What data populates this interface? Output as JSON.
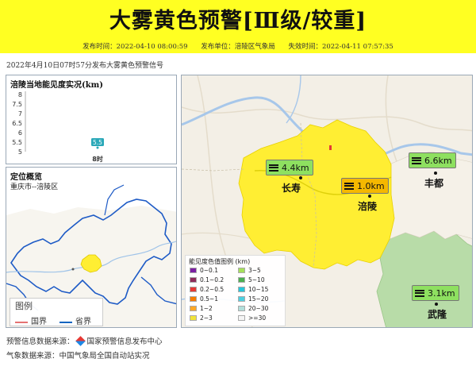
{
  "banner": {
    "title": "大雾黄色预警[Ⅲ级/较重]",
    "publish_time": "发布时间：2022-04-10 08:00:59",
    "publisher": "发布单位：涪陵区气象局",
    "expire_time": "失效时间：2022-04-11 07:57:35",
    "background_color": "#ffff22"
  },
  "headline": "2022年4月10日07时57分发布大雾黄色预警信号",
  "visibility_panel": {
    "title": "涪陵当地能见度实况(km)",
    "chart_data": {
      "type": "scatter",
      "categories": [
        "8时"
      ],
      "values": [
        5.5
      ],
      "data_labels": [
        "5.5"
      ],
      "yticks": [
        "5",
        "5.5",
        "6",
        "6.5",
        "7",
        "7.5",
        "8"
      ],
      "ylim": [
        5,
        8
      ],
      "title": "涪陵当地能见度实况(km)",
      "xlabel": "",
      "ylabel": "",
      "grid": false,
      "marker_color": "#2aa8b8"
    }
  },
  "locator_panel": {
    "title": "定位概览",
    "subtitle": "重庆市--涪陵区",
    "legend_title": "图例",
    "legend_items": [
      {
        "label": "国界",
        "color": "#e57373"
      },
      {
        "label": "省界",
        "color": "#1565c0"
      }
    ]
  },
  "main_map": {
    "stations": [
      {
        "name": "长寿",
        "visibility": "4.4km",
        "badge_color": "#8ee060"
      },
      {
        "name": "涪陵",
        "visibility": "1.0km",
        "badge_color": "#f5b800"
      },
      {
        "name": "丰都",
        "visibility": "6.6km",
        "badge_color": "#8ee060"
      },
      {
        "name": "武隆",
        "visibility": "3.1km",
        "badge_color": "#8ee060"
      }
    ],
    "warning_area_color": "#ffee33",
    "color_legend": {
      "title": "能见度色值图例 (km)",
      "items": [
        {
          "label": "0~0.1",
          "color": "#7b1fa2"
        },
        {
          "label": "0.1~0.2",
          "color": "#8e2c5a"
        },
        {
          "label": "0.2~0.5",
          "color": "#e53935"
        },
        {
          "label": "0.5~1",
          "color": "#f57c00"
        },
        {
          "label": "1~2",
          "color": "#ffa726"
        },
        {
          "label": "2~3",
          "color": "#f0e33a"
        },
        {
          "label": "3~5",
          "color": "#a5e05a"
        },
        {
          "label": "5~10",
          "color": "#4caf50"
        },
        {
          "label": "10~15",
          "color": "#26c6da"
        },
        {
          "label": "15~20",
          "color": "#4dd0e1"
        },
        {
          "label": "20~30",
          "color": "#b2dfdb"
        },
        {
          "label": ">=30",
          "color": "#f5f5f5"
        }
      ]
    }
  },
  "footer": {
    "source_label": "预警信息数据来源：",
    "source_name": "国家预警信息发布中心",
    "weather_source": "气象数据来源：中国气象局全国自动站实况"
  }
}
